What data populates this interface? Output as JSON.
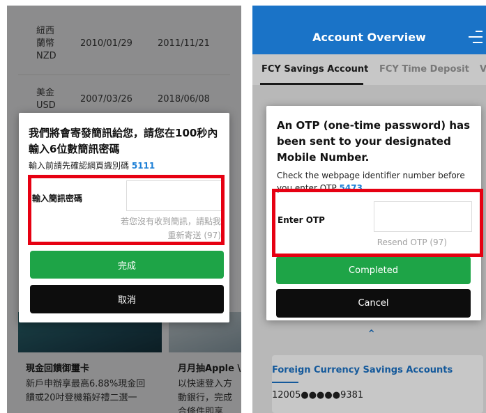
{
  "left": {
    "rates": [
      {
        "currency": "紐西\n蘭幣\nNZD",
        "date1": "2010/01/29",
        "date2": "2011/11/21"
      },
      {
        "currency": "美金\nUSD",
        "date1": "2007/03/26",
        "date2": "2018/06/08"
      }
    ],
    "dialog": {
      "heading": "我們將會寄發簡訊給您，請您在100秒內輸入6位數簡訊密碼",
      "identifier_prefix": "輸入前請先確認網頁識別碼",
      "identifier_code": "5111",
      "otp_label": "輸入簡訊密碼",
      "otp_value": "",
      "resend_text": "若您沒有收到簡訊，請點我重新寄送 (97)",
      "confirm_label": "完成",
      "cancel_label": "取消"
    },
    "promos": [
      {
        "title": "現金回饋御璽卡",
        "text": "新戶申辦享最高6.88%現金回饋或20吋登機箱好禮二選一"
      },
      {
        "title": "月月抽Apple \\",
        "text": "以快速登入方動銀行，完成合條件即享"
      }
    ]
  },
  "right": {
    "app_title": "Account Overview",
    "tabs": [
      {
        "label": "FCY Savings Account",
        "active": true
      },
      {
        "label": "FCY Time Deposit",
        "active": false
      },
      {
        "label": "V",
        "active": false
      }
    ],
    "dialog": {
      "heading": "An OTP (one-time password) has been sent to your designated Mobile Number.",
      "identifier_prefix": "Check the webpage identifier number before you enter OTP",
      "identifier_code": "5473",
      "otp_label": "Enter OTP",
      "otp_value": "",
      "resend_text": "Resend OTP (97)",
      "confirm_label": "Completed",
      "cancel_label": "Cancel"
    },
    "card": {
      "title": "Foreign Currency Savings Accounts",
      "account_number": "12005●●●●●9381"
    }
  },
  "colors": {
    "accent_blue": "#1a73c7",
    "identifier_blue": "#1c7fd6",
    "confirm_green": "#1ea447",
    "cancel_black": "#0d0d0d",
    "highlight_red": "#e60012"
  }
}
